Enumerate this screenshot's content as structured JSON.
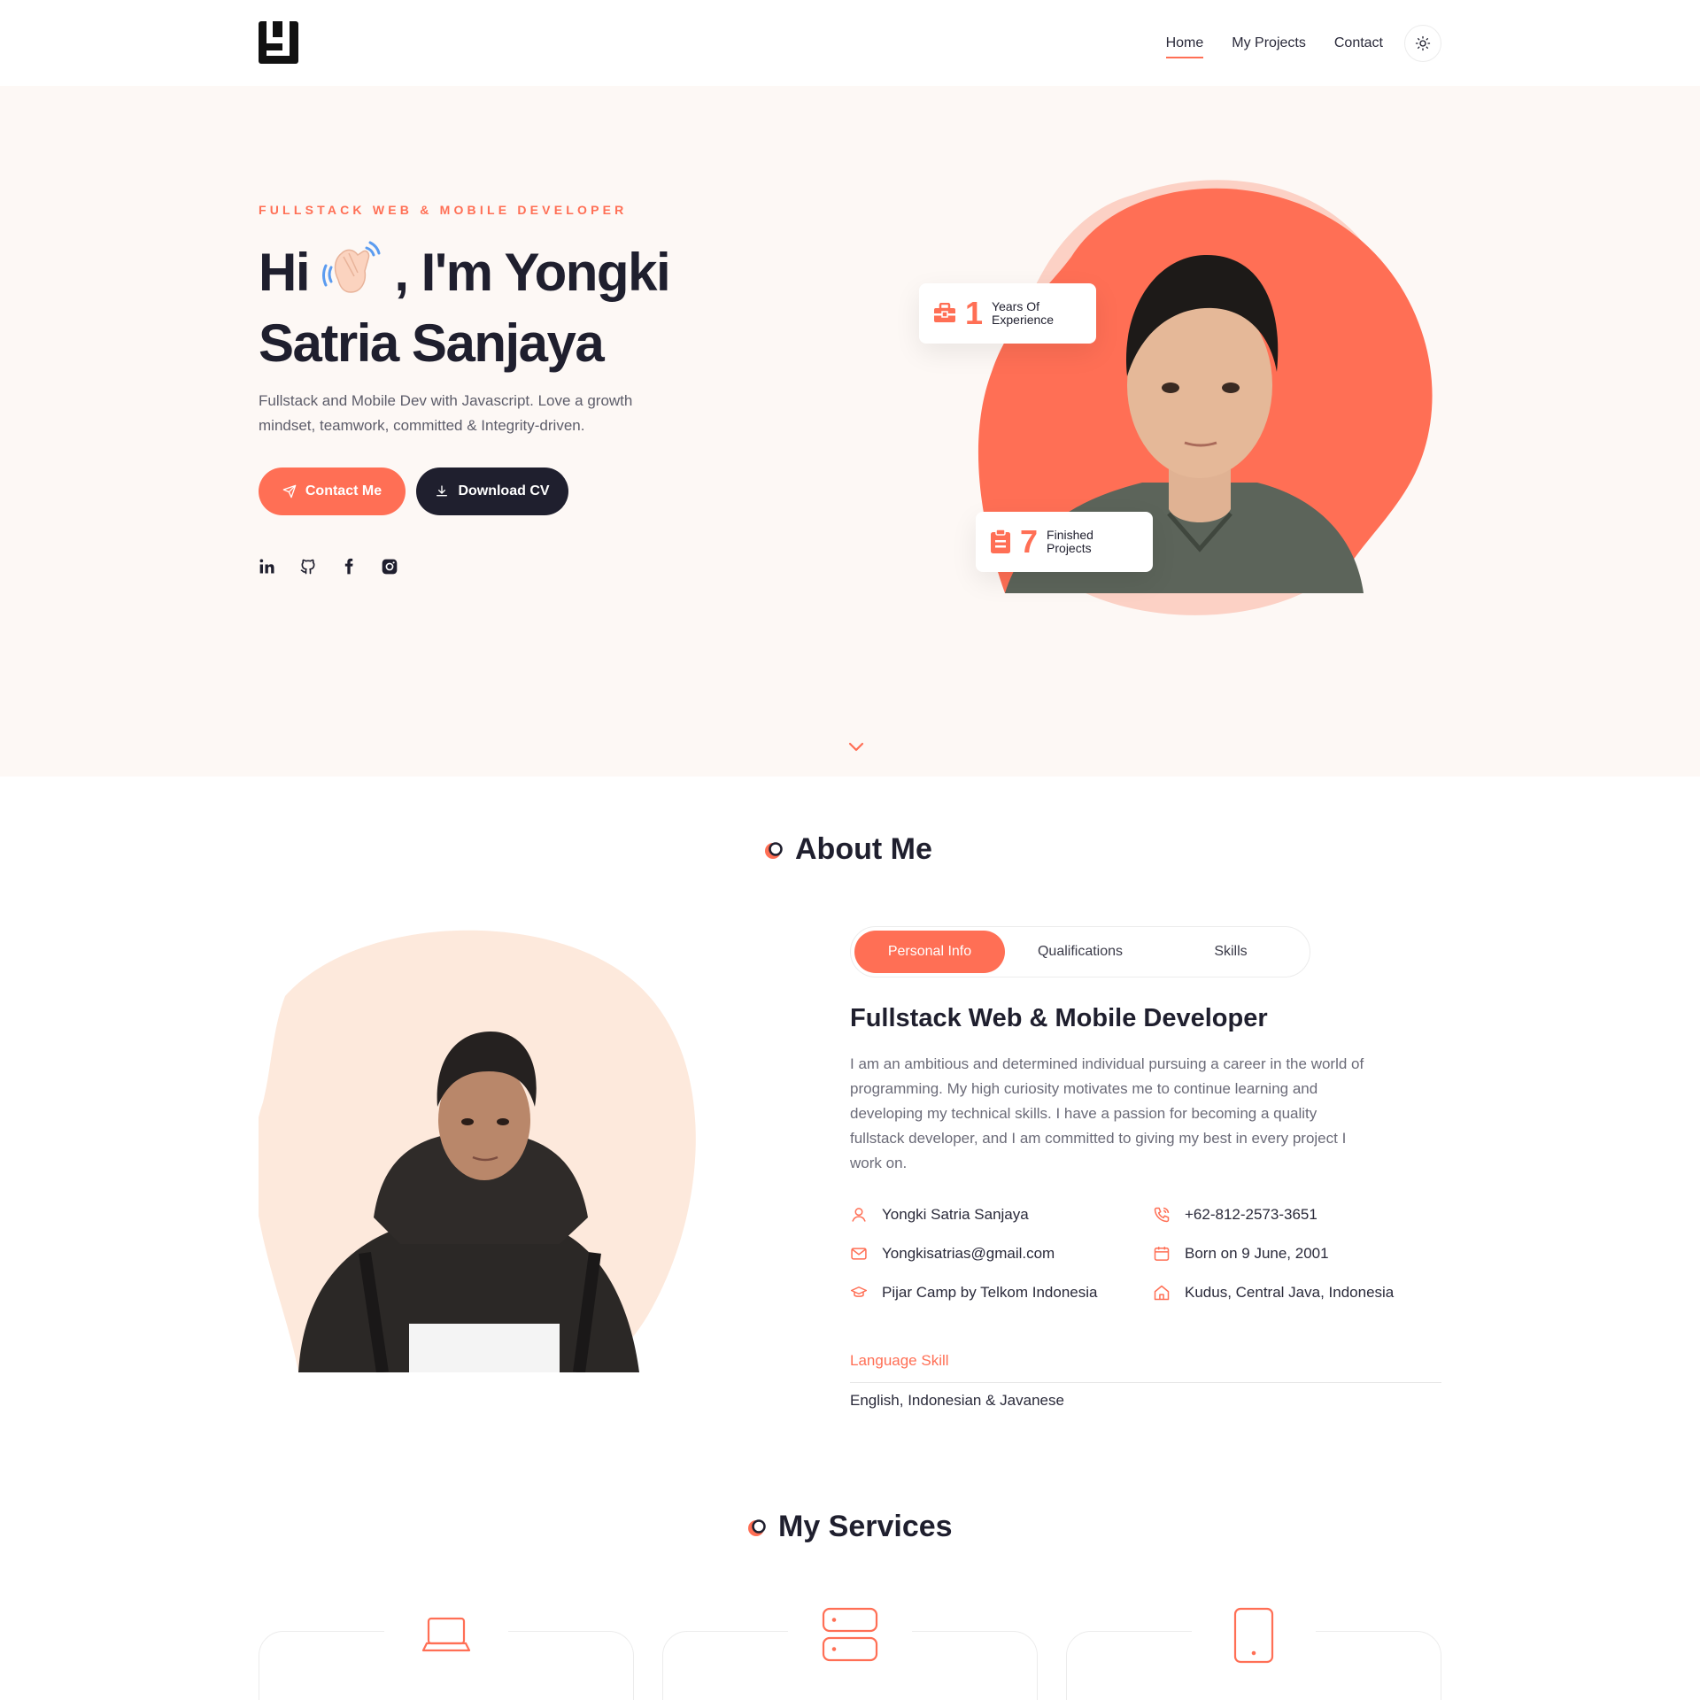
{
  "nav": {
    "logo_icon": "brand-logo-icon",
    "links": [
      "Home",
      "My Projects",
      "Contact"
    ],
    "active": "Home",
    "theme_icon": "sun-icon"
  },
  "hero": {
    "kicker": "FULLSTACK WEB & MOBILE DEVELOPER",
    "title_hi": "Hi",
    "title_rest": ", I'm Yongki",
    "title_line2": "Satria Sanjaya",
    "description": "Fullstack and Mobile Dev with Javascript. Love a growth mindset, teamwork, committed & Integrity-driven.",
    "btn_contact": "Contact Me",
    "btn_download": "Download CV",
    "socials": [
      "linkedin-icon",
      "github-icon",
      "facebook-icon",
      "instagram-icon"
    ],
    "stats": [
      {
        "num": "1",
        "label1": "Years Of",
        "label2": "Experience",
        "icon": "briefcase-icon"
      },
      {
        "num": "7",
        "label1": "Finished",
        "label2": "Projects",
        "icon": "clipboard-icon"
      }
    ]
  },
  "about": {
    "title": "About Me",
    "tabs": [
      "Personal Info",
      "Qualifications",
      "Skills"
    ],
    "active_tab": "Personal Info",
    "heading": "Fullstack Web & Mobile Developer",
    "paragraph": "I am an ambitious and determined individual pursuing a career in the world of programming. My high curiosity motivates me to continue learning and developing my technical skills. I have a passion for becoming a quality fullstack developer, and I am committed to giving my best in every project I work on.",
    "info": {
      "name": "Yongki Satria Sanjaya",
      "phone": "+62-812-2573-3651",
      "email": "Yongkisatrias@gmail.com",
      "born": "Born on 9 June, 2001",
      "education": "Pijar Camp by Telkom Indonesia",
      "location": "Kudus, Central Java, Indonesia"
    },
    "language_label": "Language Skill",
    "language_value": "English, Indonesian & Javanese"
  },
  "services": {
    "title": "My Services",
    "icons": [
      "laptop-icon",
      "server-icon",
      "mobile-icon"
    ]
  },
  "colors": {
    "accent": "#ff6f55",
    "dark": "#1f1f2e",
    "hero_bg": "#fdf8f5",
    "blob_light": "#fde9dc"
  }
}
